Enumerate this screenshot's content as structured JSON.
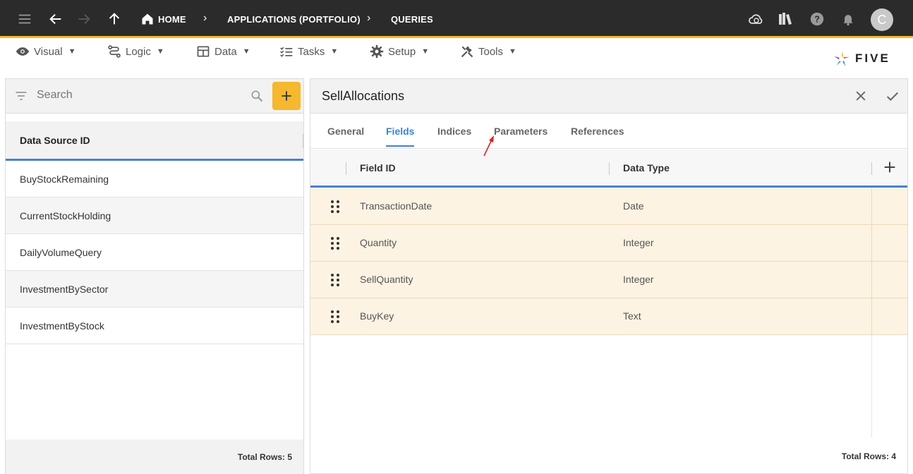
{
  "topbar": {
    "breadcrumbs": [
      "HOME",
      "APPLICATIONS (PORTFOLIO)",
      "QUERIES"
    ],
    "avatar_initial": "C"
  },
  "menubar": {
    "items": [
      {
        "label": "Visual",
        "icon": "eye-icon"
      },
      {
        "label": "Logic",
        "icon": "logic-icon"
      },
      {
        "label": "Data",
        "icon": "table-icon"
      },
      {
        "label": "Tasks",
        "icon": "tasks-icon"
      },
      {
        "label": "Setup",
        "icon": "gear-icon"
      },
      {
        "label": "Tools",
        "icon": "tools-icon"
      }
    ],
    "logo_text": "FIVE"
  },
  "left_panel": {
    "search_placeholder": "Search",
    "column_header": "Data Source ID",
    "rows": [
      "BuyStockRemaining",
      "CurrentStockHolding",
      "DailyVolumeQuery",
      "InvestmentBySector",
      "InvestmentByStock"
    ],
    "footer": "Total Rows: 5"
  },
  "right_panel": {
    "title": "SellAllocations",
    "tabs": [
      "General",
      "Fields",
      "Indices",
      "Parameters",
      "References"
    ],
    "active_tab": "Fields",
    "columns": [
      "Field ID",
      "Data Type"
    ],
    "rows": [
      {
        "field_id": "TransactionDate",
        "data_type": "Date"
      },
      {
        "field_id": "Quantity",
        "data_type": "Integer"
      },
      {
        "field_id": "SellQuantity",
        "data_type": "Integer"
      },
      {
        "field_id": "BuyKey",
        "data_type": "Text"
      }
    ],
    "footer": "Total Rows: 4"
  },
  "colors": {
    "topbar_bg": "#2b2b2b",
    "accent": "#f5b82e",
    "active_tab": "#3b82d6",
    "row_highlight": "#fdf3e2",
    "annotation_arrow": "#e02020"
  }
}
